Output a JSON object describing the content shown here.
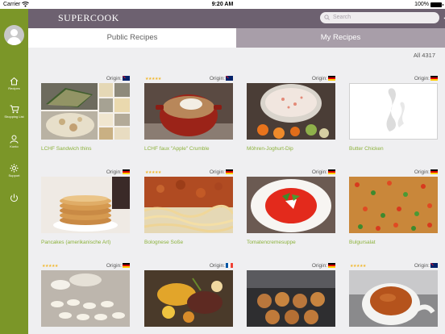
{
  "status_bar": {
    "carrier": "Carrier",
    "time": "9:20 AM",
    "battery": "100%"
  },
  "header": {
    "logo_text": "SUPERCOOK",
    "search_placeholder": "Search"
  },
  "sidebar": {
    "items": [
      {
        "label": "Recipes",
        "icon": "home-icon"
      },
      {
        "label": "Shopping List",
        "icon": "cart-icon"
      },
      {
        "label": "Konto",
        "icon": "user-icon"
      },
      {
        "label": "Support",
        "icon": "gear-icon"
      },
      {
        "label": "",
        "icon": "power-icon"
      }
    ]
  },
  "tabs": {
    "public": "Public Recipes",
    "my": "My Recipes"
  },
  "count_label": "All 4317",
  "origin_label": "Origin:",
  "colors": {
    "sidebar": "#7b9628",
    "header": "#6d6170",
    "tab_inactive": "#a89ea9",
    "title_green": "#8cb23c",
    "stars": "#f1b82d"
  },
  "recipes": [
    {
      "title": "LCHF Sandwich thins",
      "stars": "",
      "flag": "au"
    },
    {
      "title": "LCHF faux \"Apple\" Crumble",
      "stars": "★★★★★",
      "flag": "au"
    },
    {
      "title": "Möhren-Joghurt-Dip",
      "stars": "",
      "flag": "de"
    },
    {
      "title": "Butter Chicken",
      "stars": "",
      "flag": "de"
    },
    {
      "title": "Pancakes (amerikanische Art)",
      "stars": "",
      "flag": "de"
    },
    {
      "title": "Bolognese Soße",
      "stars": "★★★★★",
      "flag": "de"
    },
    {
      "title": "Tomatencremesuppe",
      "stars": "",
      "flag": "de"
    },
    {
      "title": "Bulgursalat",
      "stars": "",
      "flag": "de"
    },
    {
      "title": "",
      "stars": "★★★★★",
      "flag": "de"
    },
    {
      "title": "",
      "stars": "",
      "flag": "fr"
    },
    {
      "title": "",
      "stars": "",
      "flag": "de"
    },
    {
      "title": "",
      "stars": "★★★★★",
      "flag": "au"
    }
  ]
}
